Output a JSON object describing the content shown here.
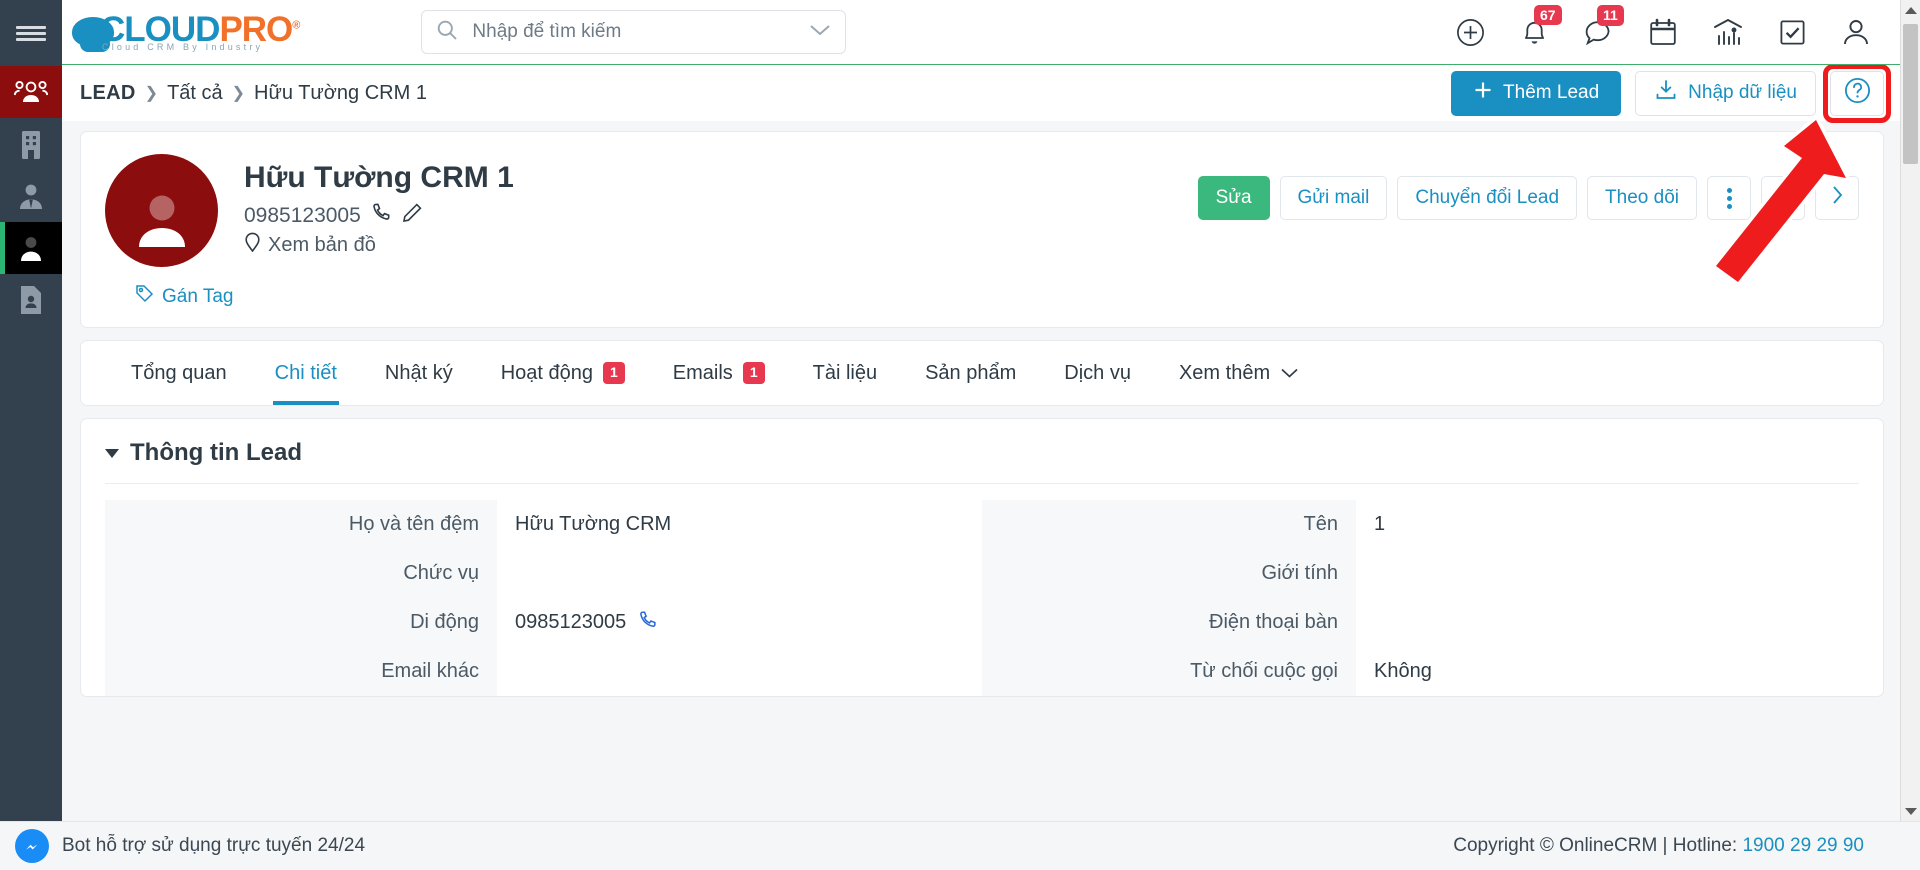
{
  "brand": {
    "name_part1": "CLOUD",
    "name_part2": "PRO",
    "registered": "®",
    "tagline": "Cloud CRM By Industry",
    "accent_blue": "#1a8fc1",
    "accent_orange": "#f1702a"
  },
  "search": {
    "placeholder": "Nhập để tìm kiếm"
  },
  "topbar": {
    "icons": [
      {
        "name": "add-circle-icon",
        "badge": ""
      },
      {
        "name": "bell-icon",
        "badge": "67"
      },
      {
        "name": "chat-bubble-icon",
        "badge": "11"
      },
      {
        "name": "calendar-icon",
        "badge": ""
      },
      {
        "name": "chart-icon",
        "badge": ""
      },
      {
        "name": "task-check-icon",
        "badge": ""
      },
      {
        "name": "user-account-icon",
        "badge": ""
      }
    ]
  },
  "sidebar": {
    "items": [
      {
        "name": "sidebar-item-contacts-group",
        "icon": "people-group-icon",
        "state": "active-red"
      },
      {
        "name": "sidebar-item-company",
        "icon": "building-icon",
        "state": ""
      },
      {
        "name": "sidebar-item-customer",
        "icon": "person-tie-icon",
        "state": ""
      },
      {
        "name": "sidebar-item-lead",
        "icon": "person-icon",
        "state": "active-dark"
      },
      {
        "name": "sidebar-item-contact-card",
        "icon": "contact-card-icon",
        "state": ""
      }
    ]
  },
  "breadcrumb": {
    "root": "LEAD",
    "sep": "❯",
    "parent": "Tất cả",
    "current": "Hữu Tường CRM 1"
  },
  "page_actions": {
    "add_lead": "Thêm Lead",
    "import": "Nhập dữ liệu",
    "help": "?",
    "help_highlighted": true,
    "highlight_color": "#ee1c1c"
  },
  "lead": {
    "name": "Hữu Tường CRM 1",
    "phone": "0985123005",
    "map_link": "Xem bản đồ",
    "tag_link": "Gán Tag",
    "avatar_color": "#8b0d0d",
    "actions": [
      {
        "label": "Sửa",
        "style": "green"
      },
      {
        "label": "Gửi mail",
        "style": "outline"
      },
      {
        "label": "Chuyển đổi Lead",
        "style": "outline"
      },
      {
        "label": "Theo dõi",
        "style": "outline"
      }
    ]
  },
  "tabs": [
    {
      "label": "Tổng quan",
      "badge": "",
      "active": false
    },
    {
      "label": "Chi tiết",
      "badge": "",
      "active": true
    },
    {
      "label": "Nhật ký",
      "badge": "",
      "active": false
    },
    {
      "label": "Hoạt động",
      "badge": "1",
      "active": false
    },
    {
      "label": "Emails",
      "badge": "1",
      "active": false
    },
    {
      "label": "Tài liệu",
      "badge": "",
      "active": false
    },
    {
      "label": "Sản phẩm",
      "badge": "",
      "active": false
    },
    {
      "label": "Dịch vụ",
      "badge": "",
      "active": false
    },
    {
      "label": "Xem thêm",
      "badge": "",
      "active": false,
      "caret": true
    }
  ],
  "detail": {
    "section_title": "Thông tin Lead",
    "left_fields": [
      {
        "label": "Họ và tên đệm",
        "value": "Hữu Tường CRM",
        "icon": ""
      },
      {
        "label": "Chức vụ",
        "value": "",
        "icon": ""
      },
      {
        "label": "Di động",
        "value": "0985123005",
        "icon": "phone-icon"
      },
      {
        "label": "Email khác",
        "value": "",
        "icon": ""
      }
    ],
    "right_fields": [
      {
        "label": "Tên",
        "value": "1",
        "icon": ""
      },
      {
        "label": "Giới tính",
        "value": "",
        "icon": ""
      },
      {
        "label": "Điện thoại bàn",
        "value": "",
        "icon": ""
      },
      {
        "label": "Từ chối cuộc gọi",
        "value": "Không",
        "icon": ""
      }
    ]
  },
  "footer": {
    "chat_label": "Bot hỗ trợ sử dụng trực tuyến 24/24",
    "copyright": "Copyright © OnlineCRM | Hotline: ",
    "hotline": "1900 29 29 90"
  }
}
